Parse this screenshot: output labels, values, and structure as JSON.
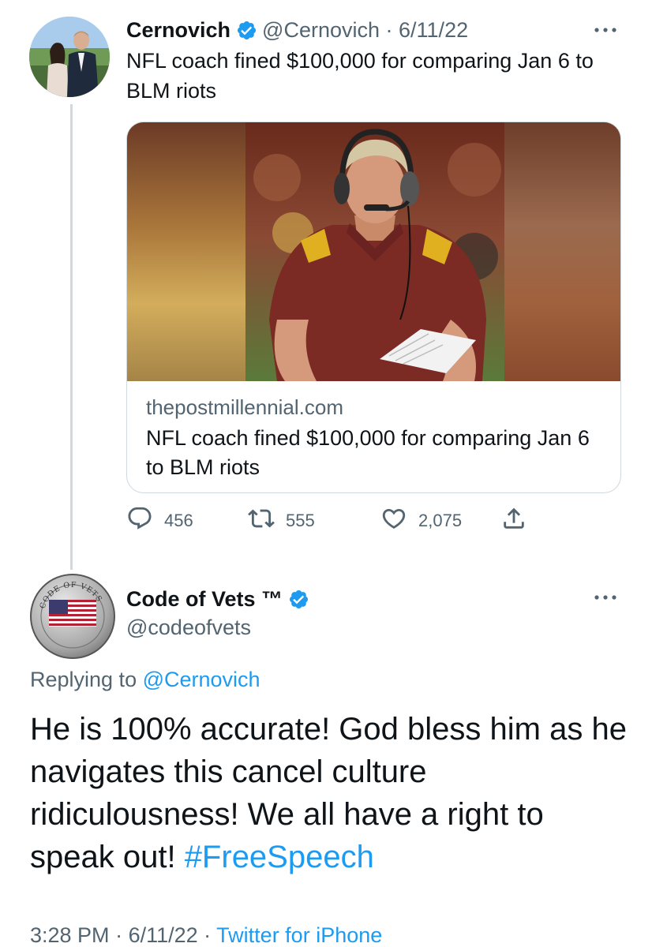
{
  "colors": {
    "text": "#0f1419",
    "secondary": "#536471",
    "link": "#1d9bf0",
    "border": "#cfd9de",
    "verified": "#1d9bf0"
  },
  "tweet1": {
    "author_name": "Cernovich",
    "author_handle": "@Cernovich",
    "date_sep": " · ",
    "date": "6/11/22",
    "verified_icon": "verified-badge-icon",
    "text": "NFL coach fined $100,000 for comparing Jan 6 to BLM riots",
    "card": {
      "domain": "thepostmillennial.com",
      "title": "NFL coach fined $100,000 for comparing Jan 6 to BLM riots",
      "image_icon": "article-photo"
    },
    "stats": {
      "replies": "456",
      "retweets": "555",
      "likes": "2,075"
    },
    "icons": [
      "reply-icon",
      "retweet-icon",
      "like-icon",
      "share-icon",
      "more-icon"
    ]
  },
  "tweet2": {
    "author_name": "Code of Vets ™",
    "author_handle": "@codeofvets",
    "replying_label": "Replying to ",
    "replying_to": "@Cernovich",
    "text": "He is 100% accurate! God bless him as he navigates this cancel culture ridiculousness! We all have a right to speak out! ",
    "hashtag": "#FreeSpeech",
    "time": "3:28 PM",
    "sep1": " · ",
    "date": "6/11/22",
    "sep2": " · ",
    "source": "Twitter for iPhone",
    "avatar_text": "CODE OF VETS"
  }
}
